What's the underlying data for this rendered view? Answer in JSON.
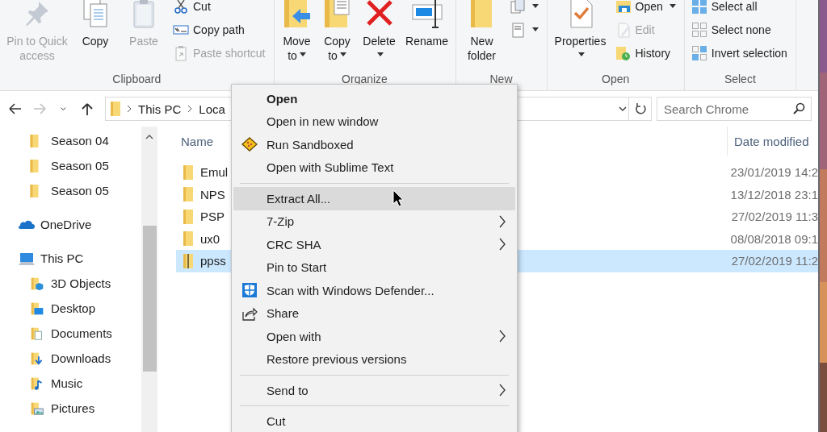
{
  "ribbon": {
    "groups": [
      {
        "label": "Clipboard",
        "controls": [
          {
            "kind": "large",
            "label": "Pin to Quick access",
            "disabled": true,
            "dropdown": false
          },
          {
            "kind": "large",
            "label": "Copy",
            "disabled": false,
            "dropdown": false
          },
          {
            "kind": "large",
            "label": "Paste",
            "disabled": true,
            "dropdown": false
          },
          {
            "kind": "stack",
            "items": [
              {
                "label": "Cut",
                "disabled": false,
                "dropdown": false
              },
              {
                "label": "Copy path",
                "disabled": false,
                "dropdown": false
              },
              {
                "label": "Paste shortcut",
                "disabled": true,
                "dropdown": false
              }
            ]
          }
        ]
      },
      {
        "label": "Organize",
        "controls": [
          {
            "kind": "large",
            "label": "Move to",
            "disabled": false,
            "dropdown": true
          },
          {
            "kind": "large",
            "label": "Copy to",
            "disabled": false,
            "dropdown": true
          },
          {
            "kind": "large",
            "label": "Delete",
            "disabled": false,
            "dropdown": true
          },
          {
            "kind": "large",
            "label": "Rename",
            "disabled": false,
            "dropdown": false
          }
        ]
      },
      {
        "label": "New",
        "controls": [
          {
            "kind": "large",
            "label": "New folder",
            "disabled": false,
            "dropdown": false
          },
          {
            "kind": "stack",
            "items": [
              {
                "disabled": false,
                "dropdown": true
              },
              {
                "disabled": false,
                "dropdown": true
              }
            ]
          }
        ]
      },
      {
        "label": "Open",
        "controls": [
          {
            "kind": "large",
            "label": "Properties",
            "disabled": false,
            "dropdown": true
          },
          {
            "kind": "stack",
            "items": [
              {
                "label": "Open",
                "disabled": false,
                "dropdown": true
              },
              {
                "label": "Edit",
                "disabled": true,
                "dropdown": false
              },
              {
                "label": "History",
                "disabled": false,
                "dropdown": false
              }
            ]
          }
        ]
      },
      {
        "label": "Select",
        "controls": [
          {
            "kind": "stack",
            "items": [
              {
                "label": "Select all",
                "disabled": false,
                "dropdown": false
              },
              {
                "label": "Select none",
                "disabled": false,
                "dropdown": false
              },
              {
                "label": "Invert selection",
                "disabled": false,
                "dropdown": false
              }
            ]
          }
        ]
      }
    ]
  },
  "address_bar": {
    "buttons": [
      {
        "disabled": false
      },
      {
        "disabled": true
      },
      {
        "disabled": false
      },
      {
        "disabled": false
      }
    ],
    "crumbs": [
      "This PC",
      "Loca"
    ]
  },
  "search": {
    "placeholder": "Search Chrome"
  },
  "navigation_pane": {
    "items": [
      {
        "children": [
          {
            "label": "Season 04",
            "selected": false
          },
          {
            "label": "Season 05",
            "selected": false
          },
          {
            "label": "Season 05",
            "selected": false
          }
        ]
      },
      {
        "label": "OneDrive",
        "selected": false
      },
      {
        "label": "This PC",
        "selected": false,
        "children": [
          {
            "label": "3D Objects",
            "selected": false
          },
          {
            "label": "Desktop",
            "selected": false
          },
          {
            "label": "Documents",
            "selected": false
          },
          {
            "label": "Downloads",
            "selected": false
          },
          {
            "label": "Music",
            "selected": false
          },
          {
            "label": "Pictures",
            "selected": false
          }
        ]
      }
    ]
  },
  "file_list": {
    "columns": [
      "Name",
      "Date modified"
    ],
    "rows": [
      {
        "name": "Emul",
        "date_modified": "23/01/2019 14:2",
        "selected": false
      },
      {
        "name": "NPS",
        "date_modified": "13/12/2018 23:1",
        "selected": false
      },
      {
        "name": "PSP",
        "date_modified": "27/02/2019 11:3",
        "selected": false
      },
      {
        "name": "ux0",
        "date_modified": "08/08/2018 09:1",
        "selected": false
      },
      {
        "name": "ppss",
        "date_modified": "27/02/2019 11:2",
        "selected": true
      }
    ]
  },
  "context_menu": {
    "items": [
      {
        "kind": "item",
        "label": "Open",
        "default": true,
        "highlighted": false,
        "submenu": false
      },
      {
        "kind": "item",
        "label": "Open in new window",
        "default": false,
        "highlighted": false,
        "submenu": false
      },
      {
        "kind": "item",
        "label": "Run Sandboxed",
        "default": false,
        "highlighted": false,
        "submenu": false
      },
      {
        "kind": "item",
        "label": "Open with Sublime Text",
        "default": false,
        "highlighted": false,
        "submenu": false
      },
      {
        "kind": "separator"
      },
      {
        "kind": "item",
        "label": "Extract All...",
        "default": false,
        "highlighted": true,
        "submenu": false
      },
      {
        "kind": "item",
        "label": "7-Zip",
        "default": false,
        "highlighted": false,
        "submenu": true
      },
      {
        "kind": "item",
        "label": "CRC SHA",
        "default": false,
        "highlighted": false,
        "submenu": true
      },
      {
        "kind": "item",
        "label": "Pin to Start",
        "default": false,
        "highlighted": false,
        "submenu": false
      },
      {
        "kind": "item",
        "label": "Scan with Windows Defender...",
        "default": false,
        "highlighted": false,
        "submenu": false
      },
      {
        "kind": "item",
        "label": "Share",
        "default": false,
        "highlighted": false,
        "submenu": false
      },
      {
        "kind": "item",
        "label": "Open with",
        "default": false,
        "highlighted": false,
        "submenu": true
      },
      {
        "kind": "item",
        "label": "Restore previous versions",
        "default": false,
        "highlighted": false,
        "submenu": false
      },
      {
        "kind": "separator"
      },
      {
        "kind": "item",
        "label": "Send to",
        "default": false,
        "highlighted": false,
        "submenu": true
      },
      {
        "kind": "separator"
      },
      {
        "kind": "item",
        "label": "Cut",
        "default": false,
        "highlighted": false,
        "submenu": false
      }
    ]
  }
}
